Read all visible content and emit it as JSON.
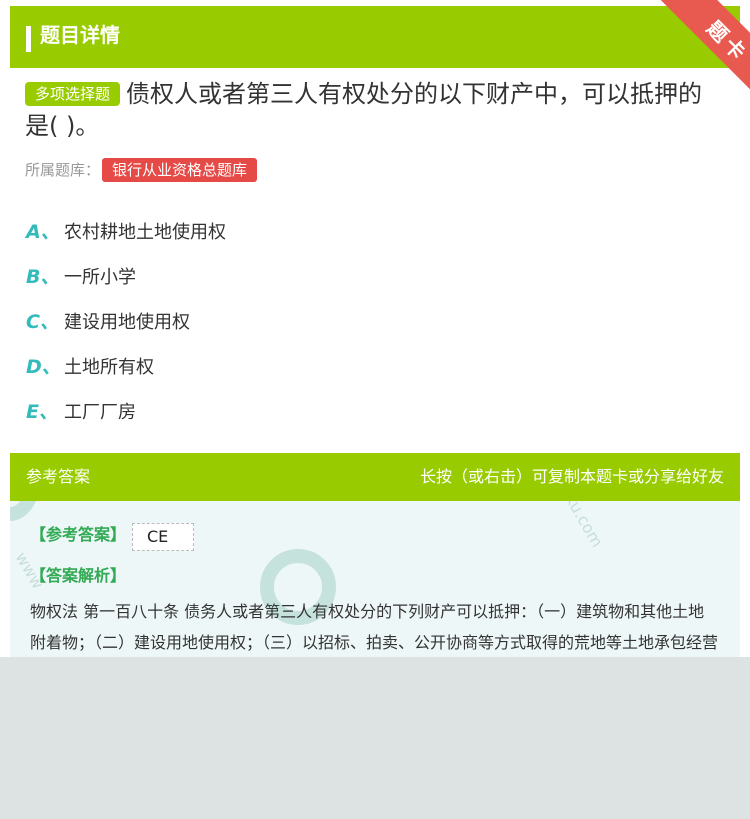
{
  "header": {
    "title": "题目详情"
  },
  "ribbon": {
    "label": "题卡"
  },
  "question": {
    "type_label": "多项选择题",
    "text": "债权人或者第三人有权处分的以下财产中，可以抵押的是( )。"
  },
  "library": {
    "label": "所属题库：",
    "name": "银行从业资格总题库"
  },
  "options": [
    {
      "letter": "A、",
      "text": "农村耕地土地使用权"
    },
    {
      "letter": "B、",
      "text": "一所小学"
    },
    {
      "letter": "C、",
      "text": "建设用地使用权"
    },
    {
      "letter": "D、",
      "text": "土地所有权"
    },
    {
      "letter": "E、",
      "text": "工厂厂房"
    }
  ],
  "answer_bar": {
    "left_label": "参考答案",
    "right_hint": "长按（或右击）可复制本题卡或分享给好友"
  },
  "answer": {
    "answer_label": "【参考答案】",
    "answer_value": "CE",
    "analysis_label": "【答案解析】",
    "analysis_text": "物权法 第一百八十条 债务人或者第三人有权处分的下列财产可以抵押：（一）建筑物和其他土地附着物；（二）建设用地使用权；（三）以招标、拍卖、公开协商等方式取得的荒地等土地承包经营权；（四）生产设备、原材料、半成品"
  },
  "colors": {
    "brand_green": "#99cc00",
    "option_letter": "#33bbbb",
    "library_tag": "#e54a46",
    "ribbon": "#e85a4f"
  }
}
